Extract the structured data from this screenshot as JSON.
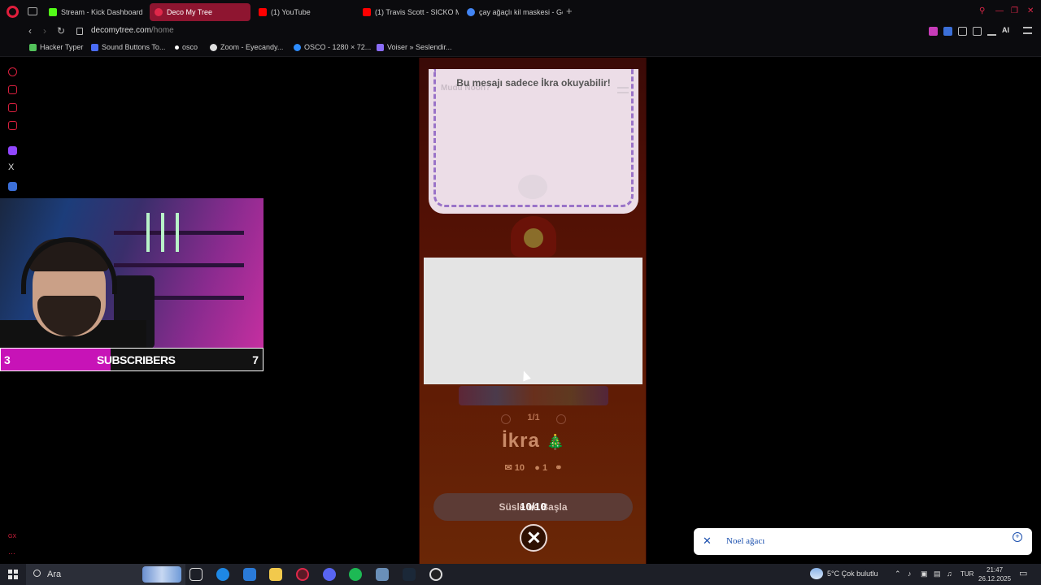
{
  "browser": {
    "tabs": [
      {
        "label": "Stream - Kick Dashboard",
        "favicon_color": "#53fc18",
        "active": false
      },
      {
        "label": "Deco My Tree",
        "favicon_color": "#e0284a",
        "active": true
      },
      {
        "label": "(1) YouTube",
        "favicon_color": "#ff0000",
        "active": false
      },
      {
        "label": "(1) Travis Scott - SICKO M",
        "favicon_color": "#ff0000",
        "active": false
      },
      {
        "label": "çay ağaçlı kil maskesi - Go",
        "favicon_color": "#4285f4",
        "active": false
      }
    ],
    "new_tab_symbol": "+",
    "url_domain": "decomytree.com",
    "url_path": "/home",
    "aria_label": "AI",
    "bookmarks": [
      {
        "label": "Hacker Typer",
        "favicon_color": "#53c25b"
      },
      {
        "label": "Sound Buttons To...",
        "favicon_color": "#4a6cf7"
      },
      {
        "label": "osco",
        "favicon_color": "#ffffff"
      },
      {
        "label": "Zoom - Eyecandy...",
        "favicon_color": "#dddddd"
      },
      {
        "label": "OSCO - 1280 × 72...",
        "favicon_color": "#2d8cff"
      },
      {
        "label": "Voiser » Seslendir...",
        "favicon_color": "#8a6cf7"
      }
    ]
  },
  "page": {
    "message_title": "Bu mesajı sadece İkra okuyabilir!",
    "logo_text": "Mudu Noon?",
    "pager": "1/1",
    "owner_name": "İkra",
    "owner_emoji": "🎄",
    "stats": {
      "messages": "10",
      "ornaments": "1"
    },
    "start_button": "Süsle ve Başla",
    "counter": "10/10"
  },
  "overlay": {
    "sub_current": "3",
    "sub_label": "SUBSCRIBERS",
    "sub_goal": "7",
    "sub_progress": 0.42,
    "accent": "#c713b7"
  },
  "notification": {
    "text": "Noel ağacı"
  },
  "taskbar": {
    "search_placeholder": "Ara",
    "weather": "5°C  Çok bulutlu",
    "language": "TUR",
    "time": "21:47",
    "date": "26.12.2025"
  }
}
